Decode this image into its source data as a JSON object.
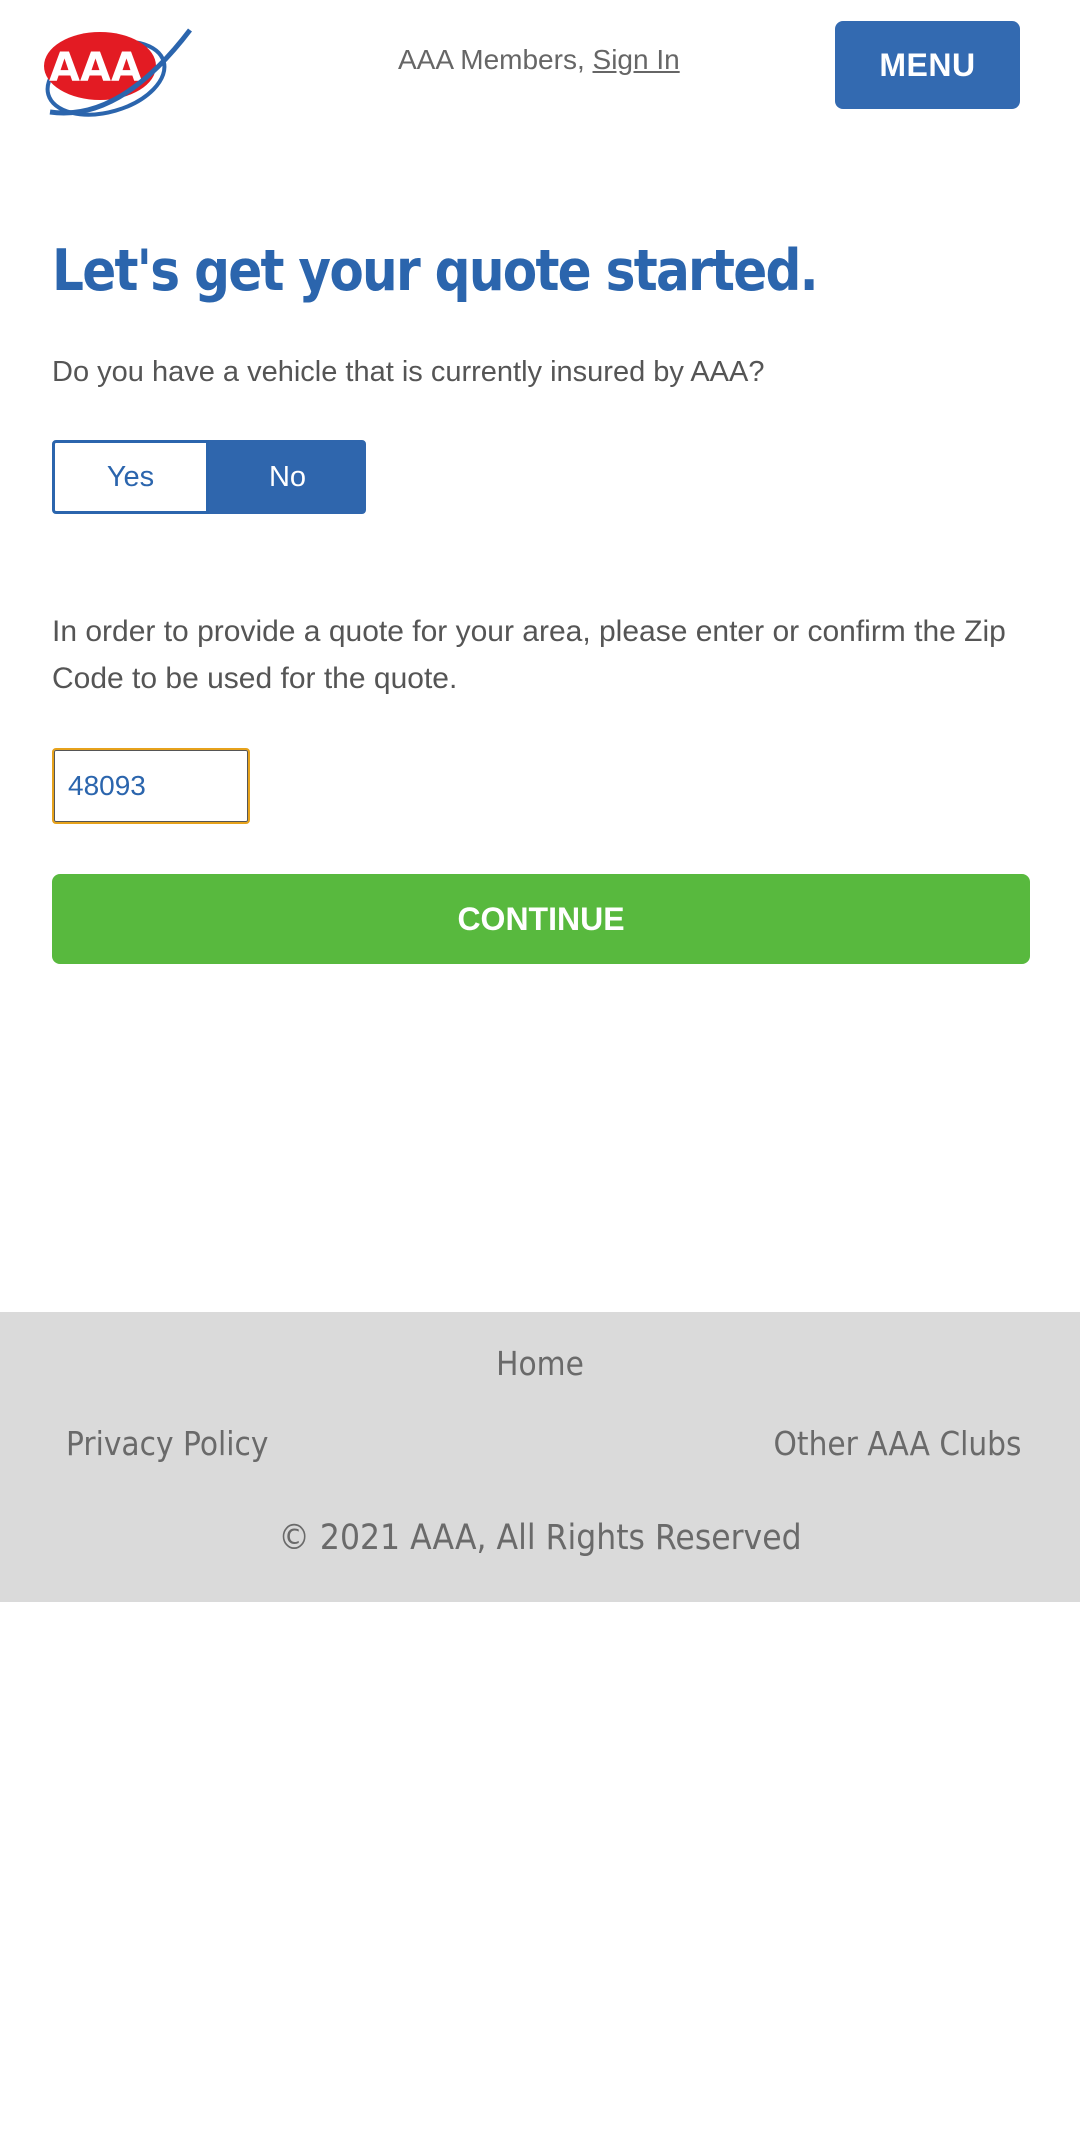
{
  "header": {
    "logo_alt": "AAA",
    "members_text": "AAA Members,",
    "sign_in_label": "Sign In",
    "menu_label": "MENU"
  },
  "main": {
    "title": "Let's get your quote started.",
    "question": "Do you have a vehicle that is currently insured by AAA?",
    "yes_label": "Yes",
    "no_label": "No",
    "selected_option": "No",
    "zip_prompt": "In order to provide a quote for your area, please enter or confirm the Zip Code to be used for the quote.",
    "zip_value": "48093",
    "continue_label": "CONTINUE"
  },
  "footer": {
    "home_label": "Home",
    "privacy_label": "Privacy Policy",
    "clubs_label": "Other AAA Clubs",
    "copyright": "© 2021 AAA, All Rights Reserved"
  },
  "colors": {
    "brand_blue": "#2b65ad",
    "menu_blue": "#336ab1",
    "continue_green": "#58b93e",
    "logo_red": "#e31b23",
    "focus_orange": "#e6a21c",
    "footer_bg": "#dadada"
  }
}
